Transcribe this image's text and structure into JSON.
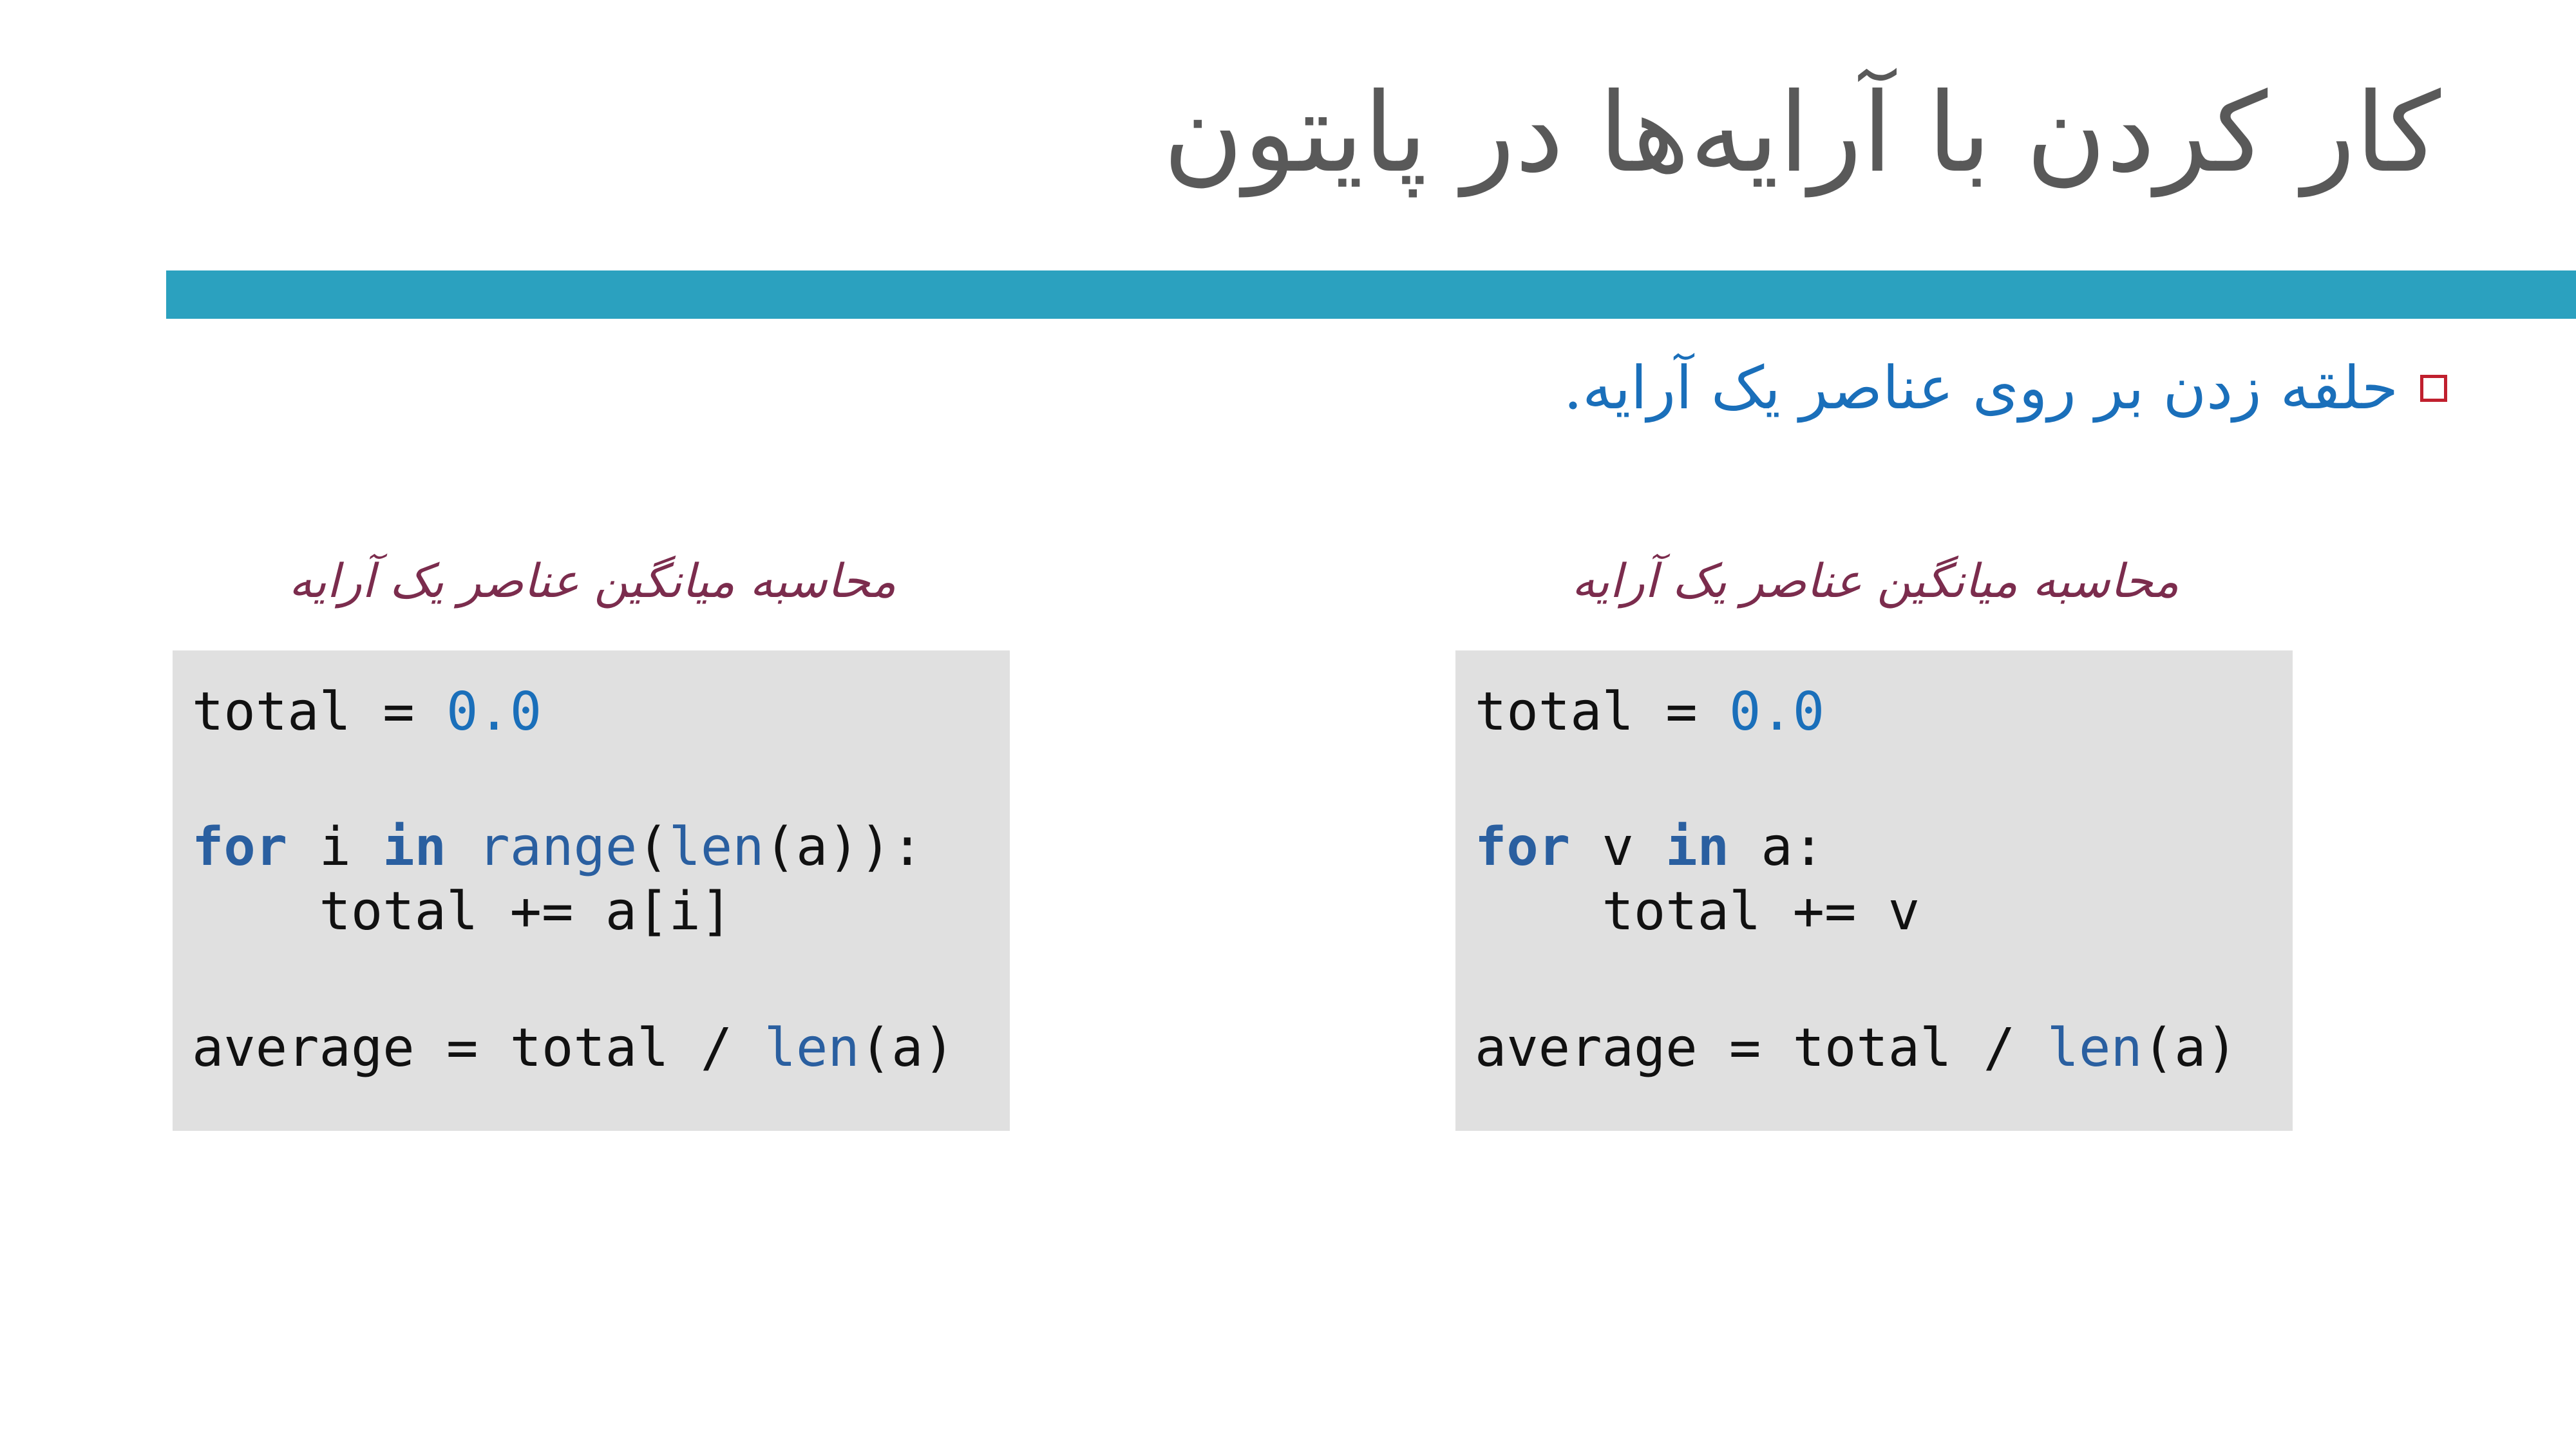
{
  "slide": {
    "title": "کار کردن با آرایه‌ها در پایتون",
    "bullet": "حلقه زدن بر روی عناصر یک آرایه.",
    "footer_faint": ". . . . . . . . . . . . . ."
  },
  "left_panel": {
    "caption": "محاسبه میانگین عناصر یک آرایه",
    "code": {
      "l1_var": "total",
      "l1_op": " = ",
      "l1_num": "0.0",
      "l2_for": "for",
      "l2_mid": " i ",
      "l2_in": "in",
      "l2_sp": " ",
      "l2_range": "range",
      "l2_p1": "(",
      "l2_len": "len",
      "l2_rest": "(a)):",
      "l3": "    total += a[i]",
      "l4_pre": "average = total / ",
      "l4_len": "len",
      "l4_rest": "(a)"
    }
  },
  "right_panel": {
    "caption": "محاسبه میانگین عناصر یک آرایه",
    "code": {
      "l1_var": "total",
      "l1_op": " = ",
      "l1_num": "0.0",
      "l2_for": "for",
      "l2_mid": " v ",
      "l2_in": "in",
      "l2_rest": " a:",
      "l3": "    total += v",
      "l4_pre": "average = total / ",
      "l4_len": "len",
      "l4_rest": "(a)"
    }
  },
  "colors": {
    "band": "#2ba1bf",
    "title": "#595959",
    "bullet_text": "#1a6fba",
    "bullet_marker": "#c0202e",
    "caption": "#7b2c4d",
    "code_bg": "#e0e0e0",
    "keyword": "#2a5fa0",
    "number": "#1a6fba"
  }
}
